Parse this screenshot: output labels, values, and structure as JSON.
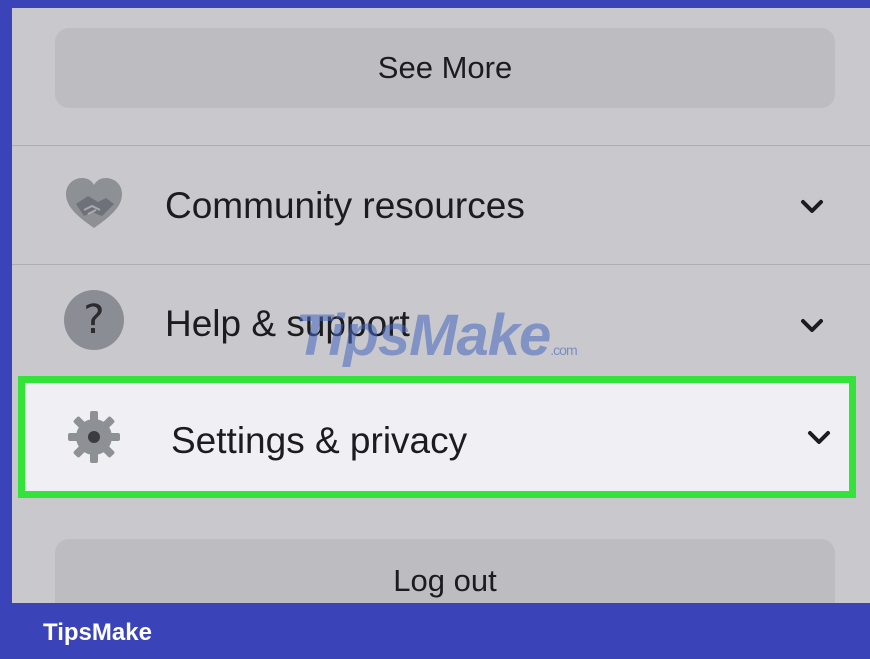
{
  "menu": {
    "see_more_label": "See More",
    "items": [
      {
        "label": "Community resources",
        "icon": "handshake-icon",
        "expand_icon": "chevron-down-icon"
      },
      {
        "label": "Help & support",
        "icon": "question-circle-icon",
        "expand_icon": "chevron-down-icon"
      },
      {
        "label": "Settings & privacy",
        "icon": "gear-icon",
        "expand_icon": "chevron-down-icon",
        "highlighted": true
      }
    ],
    "logout_label": "Log out"
  },
  "watermark": {
    "main": "TipsMake",
    "suffix": ".com"
  },
  "footer": {
    "brand": "TipsMake"
  },
  "colors": {
    "frame": "#3a44b8",
    "screen_bg": "#c9c9cd",
    "button_bg": "#bdbdc1",
    "highlight_border": "#34e33a",
    "highlight_bg": "#f0f0f4"
  }
}
